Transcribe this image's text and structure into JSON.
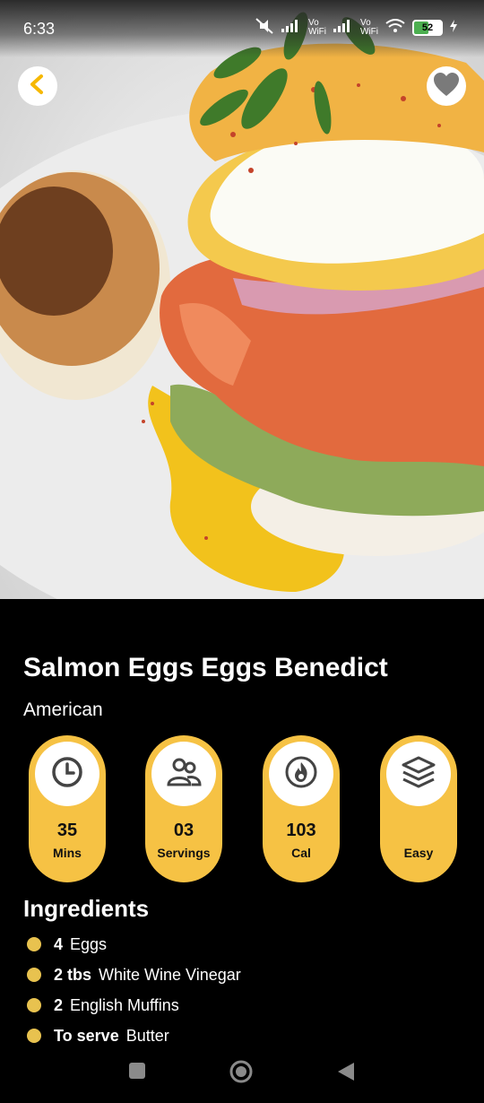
{
  "status": {
    "time": "6:33",
    "volte1": "Vo WiFi",
    "volte2": "Vo WiFi",
    "battery": "52",
    "battery_level": 0.52
  },
  "hero": {
    "image": "salmon-eggs-benedict-photo"
  },
  "recipe": {
    "title": "Salmon Eggs Eggs Benedict",
    "cuisine": "American"
  },
  "stats": [
    {
      "icon": "clock-icon",
      "value": "35",
      "label": "Mins"
    },
    {
      "icon": "people-icon",
      "value": "03",
      "label": "Servings"
    },
    {
      "icon": "flame-icon",
      "value": "103",
      "label": "Cal"
    },
    {
      "icon": "layers-icon",
      "value": "",
      "label": "Easy"
    }
  ],
  "ingredients_title": "Ingredients",
  "ingredients": [
    {
      "qty": "4",
      "name": "Eggs"
    },
    {
      "qty": "2 tbs",
      "name": "White Wine Vinegar"
    },
    {
      "qty": "2",
      "name": "English Muffins"
    },
    {
      "qty": "To serve",
      "name": "Butter"
    }
  ],
  "colors": {
    "accent": "#f6c244",
    "bullet": "#e8c24f",
    "background": "#000000"
  }
}
